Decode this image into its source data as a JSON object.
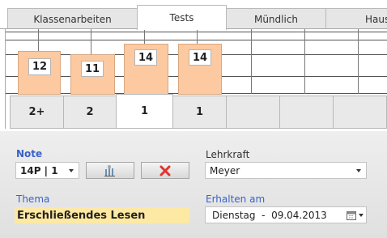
{
  "tabs": [
    {
      "label": "Klassenarbeiten",
      "active": false
    },
    {
      "label": "Tests",
      "active": true
    },
    {
      "label": "Mündlich",
      "active": false
    },
    {
      "label": "Haus",
      "active": false
    }
  ],
  "chart": {
    "bars": [
      "12",
      "11",
      "14",
      "14"
    ]
  },
  "grade_boxes": [
    {
      "label": "2+",
      "active": false
    },
    {
      "label": "2",
      "active": false
    },
    {
      "label": "1",
      "active": true
    },
    {
      "label": "1",
      "active": false
    },
    {
      "label": "",
      "active": false
    },
    {
      "label": "",
      "active": false
    },
    {
      "label": "",
      "active": false
    }
  ],
  "note": {
    "label": "Note",
    "value": "14P | 1"
  },
  "teacher": {
    "label": "Lehrkraft",
    "value": "Meyer"
  },
  "topic": {
    "label": "Thema",
    "value": "Erschließendes Lesen"
  },
  "received": {
    "label": "Erhalten am",
    "value": "Dienstag  -  09.04.2013"
  },
  "colors": {
    "bar_fill": "#fcc9a0",
    "label_blue": "#3a62c8",
    "topic_highlight": "#fde9a3",
    "delete_red": "#e0332b"
  },
  "icons": [
    "chart-icon",
    "delete-icon",
    "calendar-icon"
  ]
}
